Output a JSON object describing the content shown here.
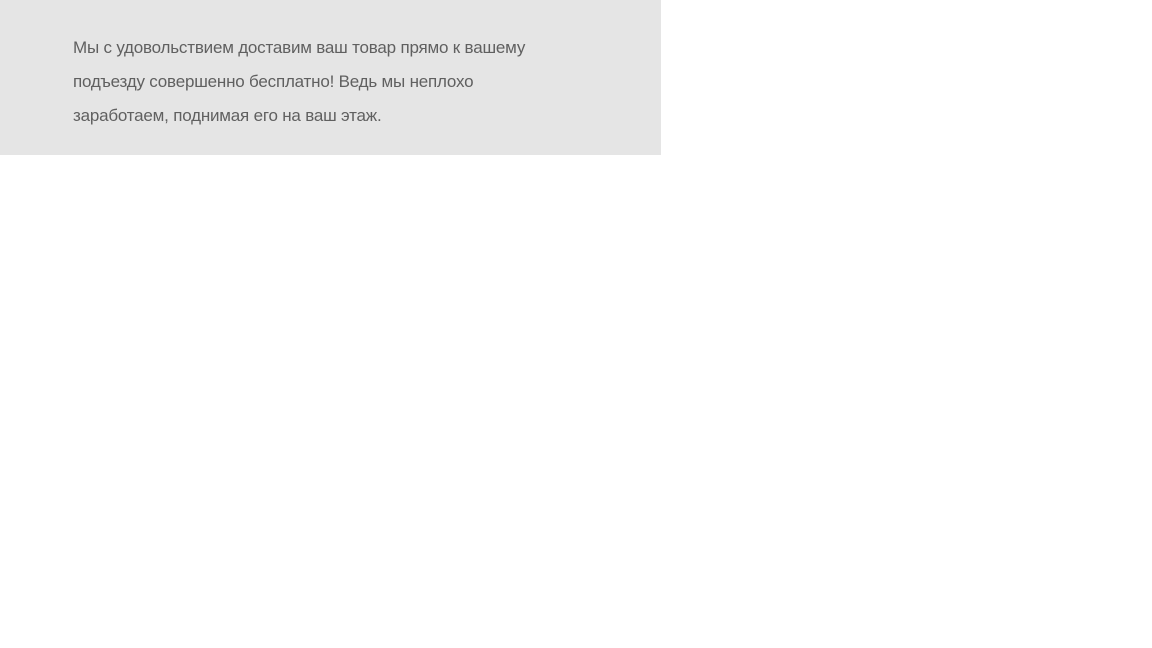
{
  "panel": {
    "background": "#e5e5e5",
    "text_color": "#606060",
    "text": "Мы с удовольствием доставим ваш товар прямо к вашему подъезду совершенно бесплатно! Ведь мы неплохо заработаем, поднимая его на ваш этаж."
  }
}
